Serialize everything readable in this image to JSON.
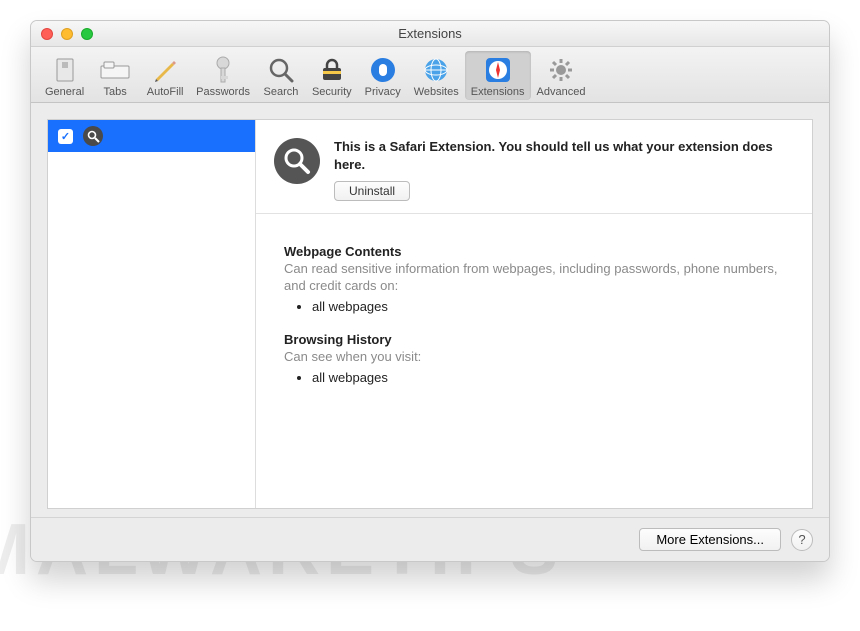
{
  "window": {
    "title": "Extensions"
  },
  "toolbar": {
    "items": [
      {
        "label": "General"
      },
      {
        "label": "Tabs"
      },
      {
        "label": "AutoFill"
      },
      {
        "label": "Passwords"
      },
      {
        "label": "Search"
      },
      {
        "label": "Security"
      },
      {
        "label": "Privacy"
      },
      {
        "label": "Websites"
      },
      {
        "label": "Extensions"
      },
      {
        "label": "Advanced"
      }
    ],
    "selected_index": 8
  },
  "sidebar": {
    "items": [
      {
        "checked": true,
        "icon": "search-icon",
        "name": ""
      }
    ]
  },
  "detail": {
    "description": "This is a Safari Extension. You should tell us what your extension does here.",
    "uninstall_label": "Uninstall",
    "sections": [
      {
        "title": "Webpage Contents",
        "text": "Can read sensitive information from webpages, including passwords, phone numbers, and credit cards on:",
        "bullets": [
          "all webpages"
        ]
      },
      {
        "title": "Browsing History",
        "text": "Can see when you visit:",
        "bullets": [
          "all webpages"
        ]
      }
    ]
  },
  "footer": {
    "more_label": "More Extensions...",
    "help_label": "?"
  },
  "watermark": "MALWARETIPS"
}
